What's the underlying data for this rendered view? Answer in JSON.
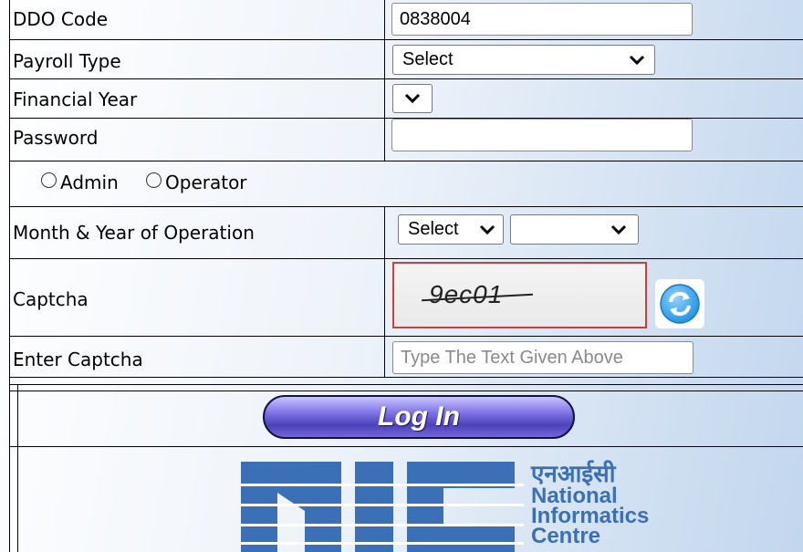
{
  "form": {
    "ddo_code": {
      "label": "DDO Code",
      "value": "0838004"
    },
    "payroll_type": {
      "label": "Payroll Type",
      "selected": "Select"
    },
    "financial_year": {
      "label": "Financial Year",
      "selected": ""
    },
    "password": {
      "label": "Password",
      "value": ""
    },
    "role": {
      "options": [
        "Admin",
        "Operator"
      ],
      "selected": null
    },
    "month_year": {
      "label": "Month & Year of Operation",
      "month_selected": "Select",
      "year_selected": ""
    },
    "captcha": {
      "label": "Captcha",
      "text": "9ec01"
    },
    "enter_captcha": {
      "label": "Enter Captcha",
      "placeholder": "Type The Text Given Above"
    },
    "login_label": "Log In"
  },
  "logo": {
    "hindi": "एनआईसी",
    "line1": "National",
    "line2": "Informatics",
    "line3": "Centre"
  },
  "colors": {
    "logo_blue": "#3b6fb6",
    "button_purple": "#5a4fcf",
    "captcha_border": "#d43c3c"
  }
}
